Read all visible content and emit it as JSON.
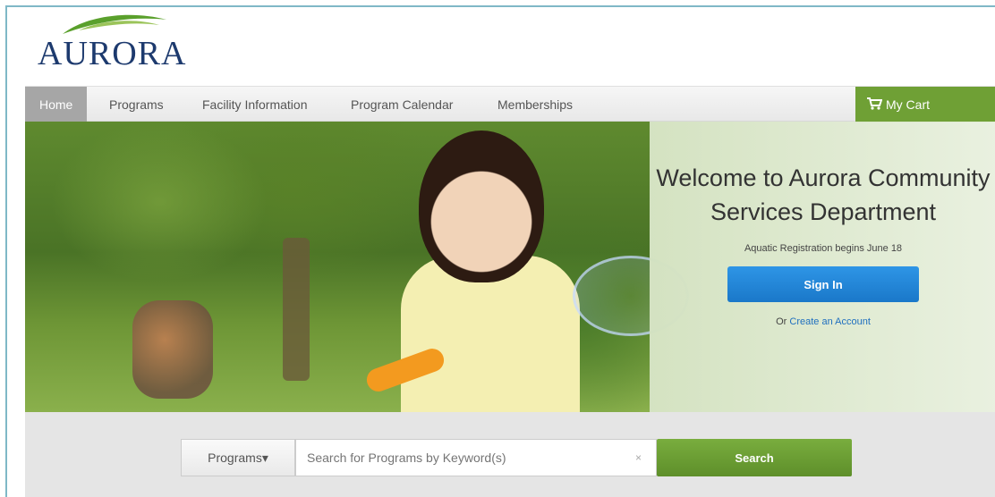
{
  "logo": {
    "text": "AURORA"
  },
  "nav": {
    "items": [
      {
        "label": "Home"
      },
      {
        "label": "Programs"
      },
      {
        "label": "Facility Information"
      },
      {
        "label": "Program Calendar"
      },
      {
        "label": "Memberships"
      }
    ],
    "cart_label": "My Cart",
    "cart_icon": "shopping-cart-icon"
  },
  "hero": {
    "title": "Welcome to Aurora Community Services Department",
    "note": "Aquatic Registration begins June 18",
    "signin_label": "Sign In",
    "account_prefix": "Or",
    "account_link": "Create an Account"
  },
  "search": {
    "category": "Programs▾",
    "placeholder": "Search for Programs by Keyword(s)",
    "clear": "×",
    "button_label": "Search"
  },
  "colors": {
    "brand_navy": "#1d3a6e",
    "cart_green": "#6fa035",
    "signin_blue": "#1a78c9",
    "search_green": "#5e8f2a"
  }
}
